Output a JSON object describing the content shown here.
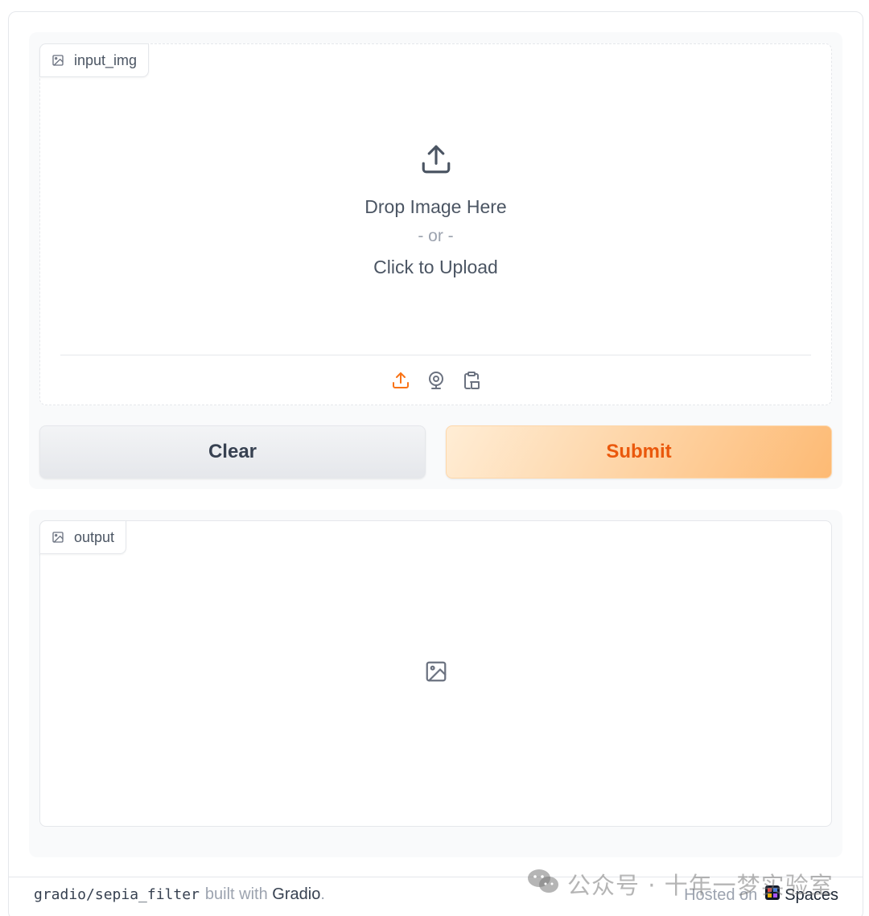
{
  "input": {
    "label": "input_img",
    "upload_main": "Drop Image Here",
    "upload_or": "- or -",
    "upload_click": "Click to Upload",
    "sources": [
      "upload-icon",
      "webcam-icon",
      "clipboard-icon"
    ],
    "active_source_color": "#f97316"
  },
  "actions": {
    "clear_label": "Clear",
    "submit_label": "Submit"
  },
  "output": {
    "label": "output"
  },
  "footer": {
    "repo": "gradio/sepia_filter",
    "built_with": "built with",
    "gradio_link": "Gradio",
    "period": ".",
    "hosted_on": "Hosted on",
    "spaces_label": "Spaces"
  },
  "watermark": {
    "text": "公众号 · 十年一梦实验室"
  },
  "colors": {
    "accent": "#f97316",
    "submit_text": "#ea580c",
    "panel_bg": "#f9fafb",
    "border": "#e5e7eb"
  }
}
